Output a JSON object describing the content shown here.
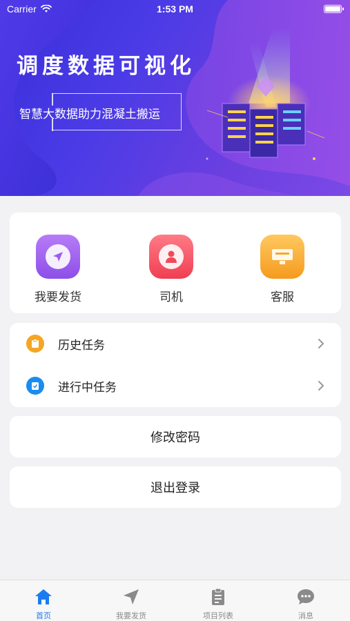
{
  "status_bar": {
    "carrier": "Carrier",
    "time": "1:53 PM"
  },
  "banner": {
    "title": "调度数据可视化",
    "subtitle": "智慧大数据助力混凝土搬运"
  },
  "quick_actions": [
    {
      "label": "我要发货",
      "icon": "send-location-icon",
      "color": "#9b5cf0"
    },
    {
      "label": "司机",
      "icon": "driver-icon",
      "color": "#f04a5a"
    },
    {
      "label": "客服",
      "icon": "customer-service-icon",
      "color": "#f7a928"
    }
  ],
  "tasks": [
    {
      "label": "历史任务",
      "icon": "clipboard-icon",
      "color": "#f5a623"
    },
    {
      "label": "进行中任务",
      "icon": "clipboard-check-icon",
      "color": "#1a8cf0"
    }
  ],
  "actions": {
    "change_password": "修改密码",
    "logout": "退出登录"
  },
  "tabbar": [
    {
      "label": "首页",
      "icon": "home-icon",
      "active": true
    },
    {
      "label": "我要发货",
      "icon": "send-icon",
      "active": false
    },
    {
      "label": "项目列表",
      "icon": "list-icon",
      "active": false
    },
    {
      "label": "消息",
      "icon": "message-icon",
      "active": false
    }
  ],
  "colors": {
    "accent": "#1a7cf0",
    "banner_start": "#3a2fd8",
    "banner_end": "#7a4ae6"
  }
}
